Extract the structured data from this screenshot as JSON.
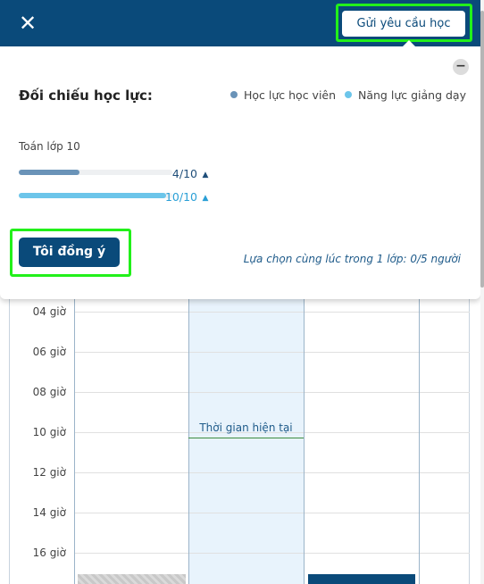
{
  "header": {
    "close_icon": "close-icon",
    "send_request_label": "Gửi yêu cầu học"
  },
  "popup": {
    "title": "Đối chiếu học lực:",
    "collapse_icon": "minus-circle-icon",
    "legend": [
      {
        "label": "Học lực học viên",
        "color": "#6a93b8"
      },
      {
        "label": "Năng lực giảng dạy",
        "color": "#6cc5ea"
      }
    ],
    "subject": "Toán lớp 10",
    "student_score": {
      "text": "4/10",
      "fraction": 0.4,
      "color": "#6a93b8",
      "icon": "graduation-cap-icon"
    },
    "teacher_score": {
      "text": "10/10",
      "fraction": 1.0,
      "color": "#6cc5ea",
      "icon": "graduation-cap-icon"
    },
    "agree_label": "Tôi đồng ý",
    "note": "Lựa chọn cùng lúc trong 1 lớp: 0/5 người"
  },
  "calendar": {
    "hours": [
      "04 giờ",
      "06 giờ",
      "08 giờ",
      "10 giờ",
      "12 giờ",
      "14 giờ",
      "16 giờ"
    ],
    "current_time_label": "Thời gian hiện tại"
  }
}
